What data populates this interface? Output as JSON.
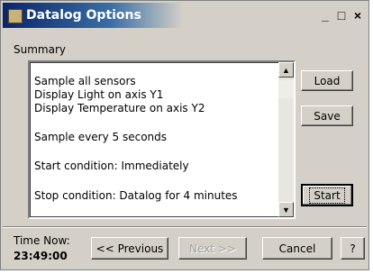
{
  "window": {
    "title": "Datalog Options",
    "minimize_label": "_",
    "maximize_label": "□",
    "close_label": "×"
  },
  "summary": {
    "label": "Summary",
    "lines": [
      "Sample all sensors",
      "Display Light on axis Y1",
      "Display Temperature on axis Y2",
      "",
      "Sample every 5 seconds",
      "",
      "Start condition: Immediately",
      "",
      "Stop condition: Datalog for 4 minutes"
    ]
  },
  "buttons": {
    "load": "Load",
    "save": "Save",
    "start": "Start",
    "previous": "<< Previous",
    "next": "Next >>",
    "cancel": "Cancel",
    "help": "?"
  },
  "time": {
    "label": "Time Now:",
    "value": "23:49:00"
  },
  "scroll": {
    "up": "▲",
    "down": "▼"
  }
}
